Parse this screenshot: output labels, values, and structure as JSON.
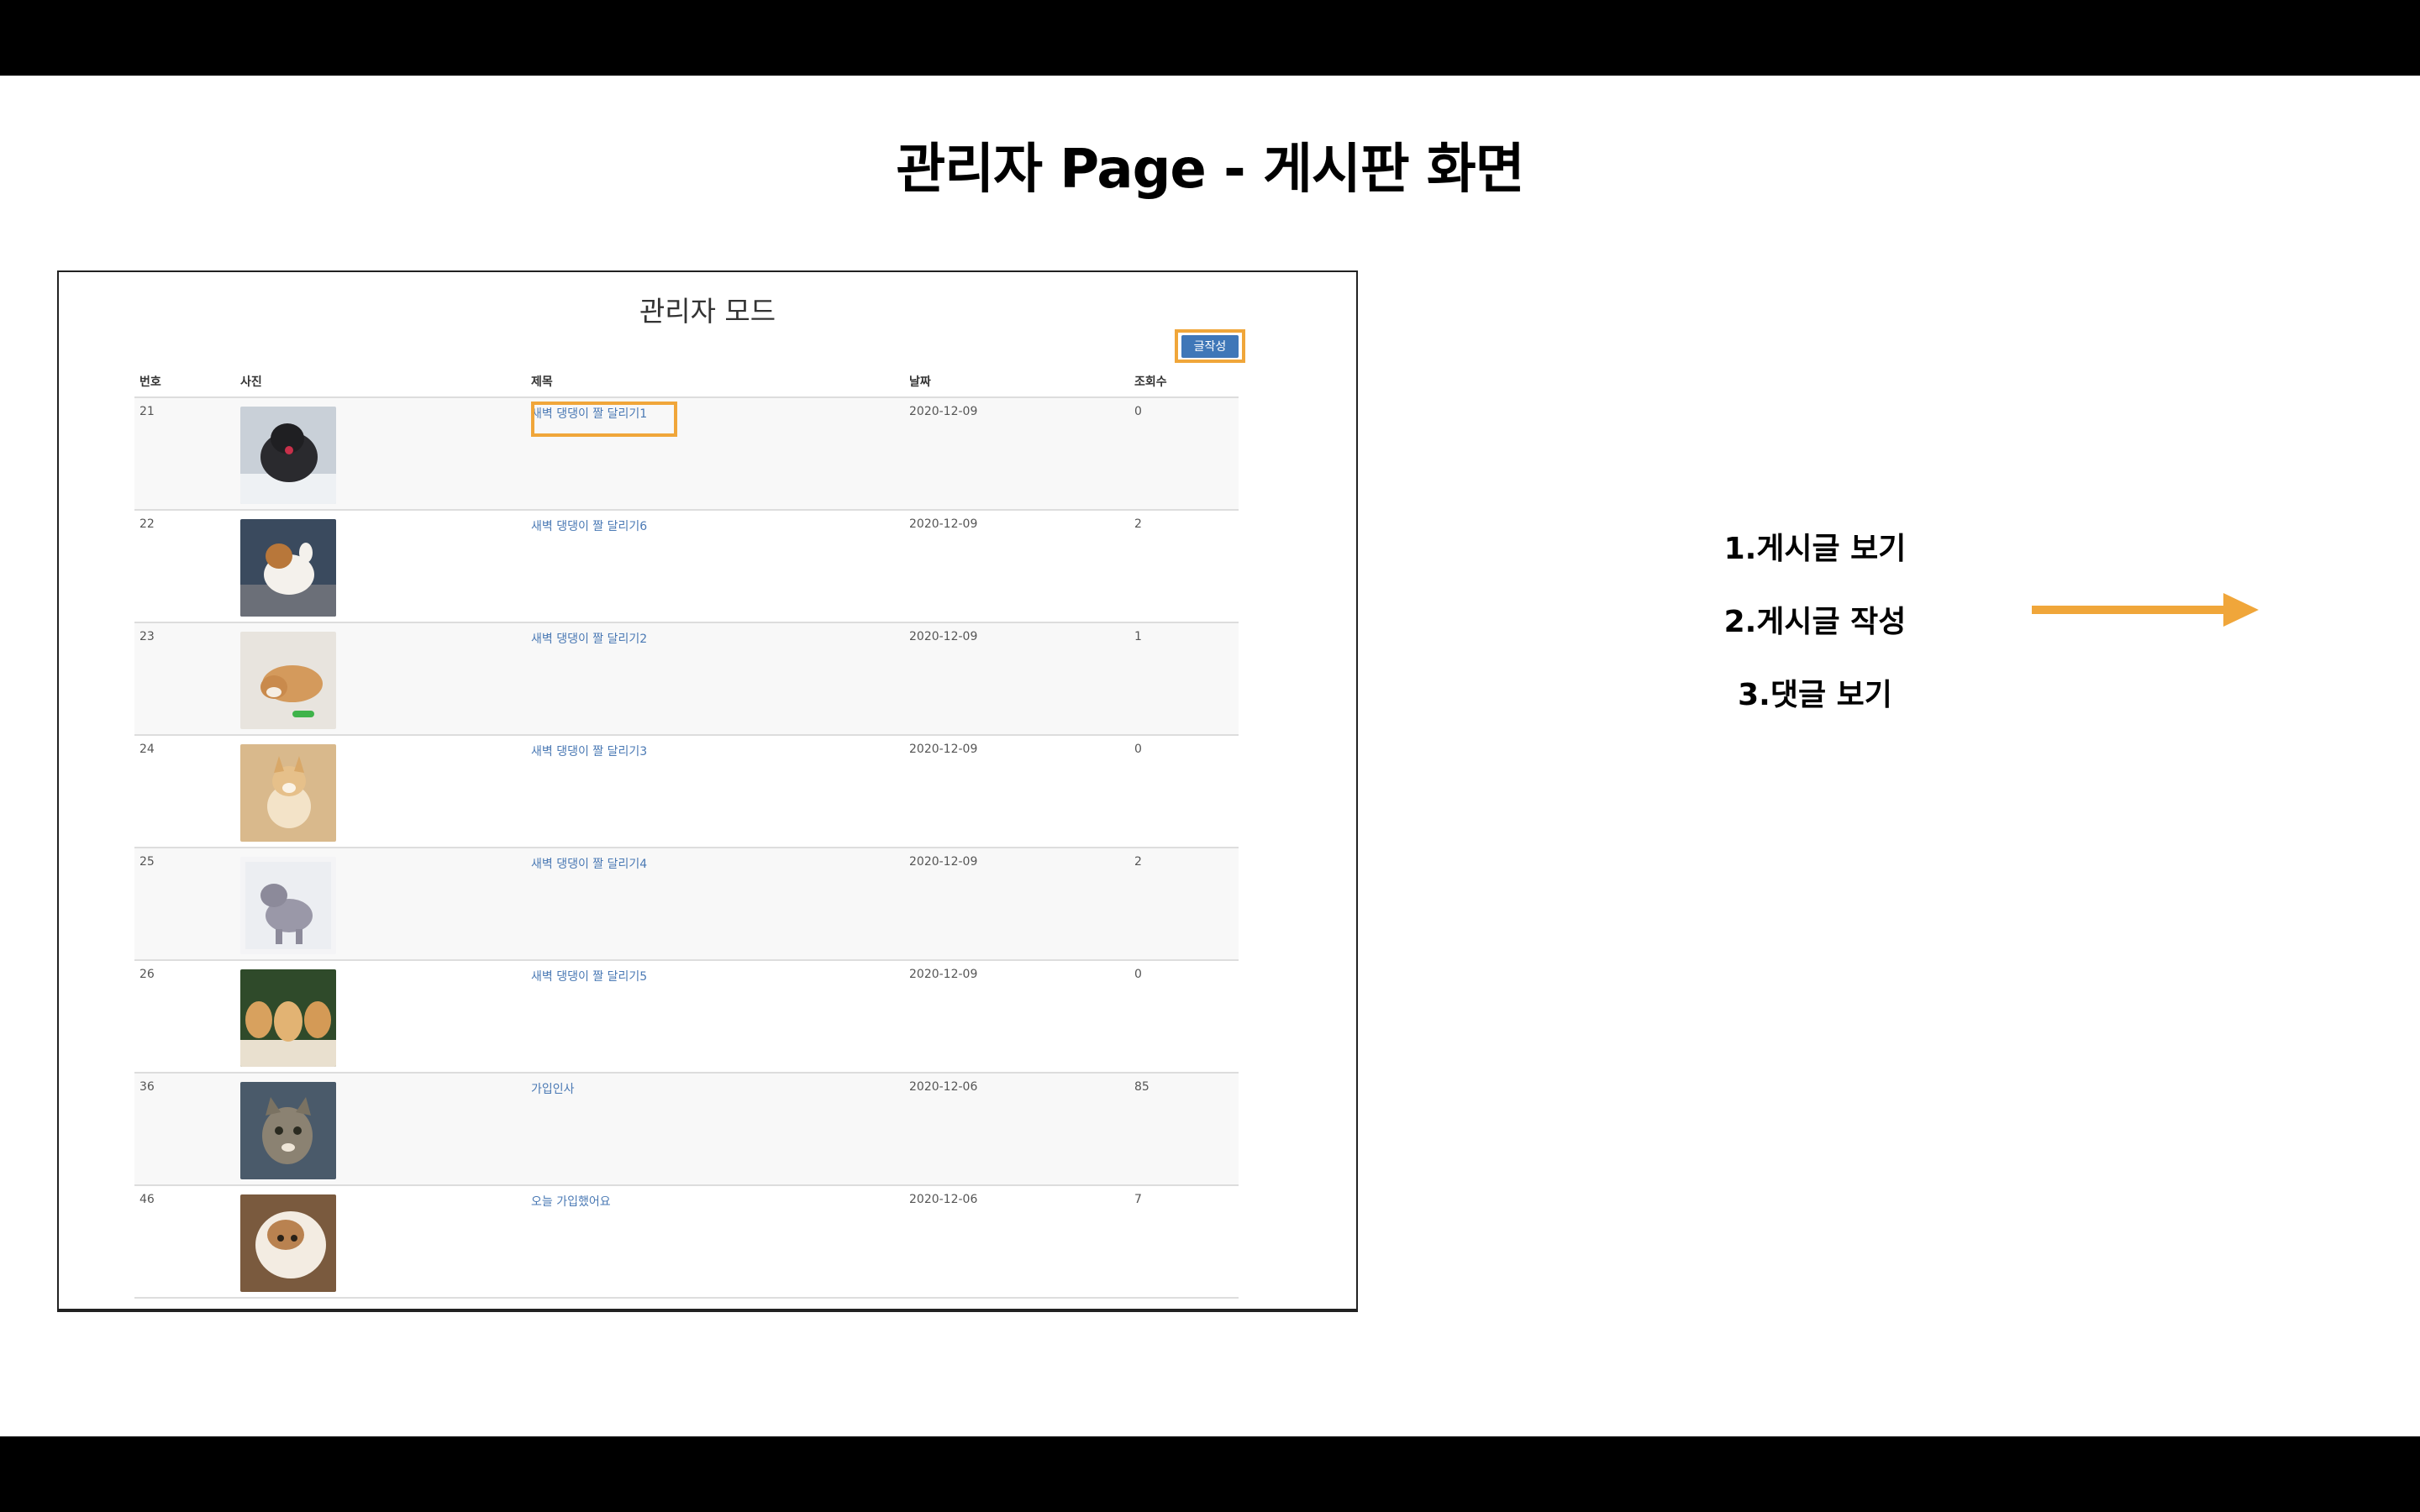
{
  "slide": {
    "title": "관리자 Page - 게시판 화면"
  },
  "admin_page": {
    "title": "관리자 모드",
    "write_button": "글작성",
    "columns": [
      "번호",
      "사진",
      "제목",
      "날짜",
      "조회수"
    ],
    "rows": [
      {
        "no": "21",
        "title": "새벽 댕댕이 짤 달리기1",
        "date": "2020-12-09",
        "views": "0",
        "photo_icon": "puppy-photo-black"
      },
      {
        "no": "22",
        "title": "새벽 댕댕이 짤 달리기6",
        "date": "2020-12-09",
        "views": "2",
        "photo_icon": "puppy-photo-brown-white"
      },
      {
        "no": "23",
        "title": "새벽 댕댕이 짤 달리기2",
        "date": "2020-12-09",
        "views": "1",
        "photo_icon": "puppy-photo-shiba"
      },
      {
        "no": "24",
        "title": "새벽 댕댕이 짤 달리기3",
        "date": "2020-12-09",
        "views": "0",
        "photo_icon": "puppy-photo-corgi"
      },
      {
        "no": "25",
        "title": "새벽 댕댕이 짤 달리기4",
        "date": "2020-12-09",
        "views": "2",
        "photo_icon": "puppy-photo-grey"
      },
      {
        "no": "26",
        "title": "새벽 댕댕이 짤 달리기5",
        "date": "2020-12-09",
        "views": "0",
        "photo_icon": "puppies-photo-group"
      },
      {
        "no": "36",
        "title": "가입인사",
        "date": "2020-12-06",
        "views": "85",
        "photo_icon": "cat-photo-tabby"
      },
      {
        "no": "46",
        "title": "오늘 가입했어요",
        "date": "2020-12-06",
        "views": "7",
        "photo_icon": "cat-photo-white-brown"
      }
    ]
  },
  "annotations": {
    "items": [
      "1.게시글 보기",
      "2.게시글 작성",
      "3.댓글 보기"
    ]
  },
  "colors": {
    "highlight": "#f0a63a",
    "button": "#3f77b8",
    "link": "#4a79b4"
  }
}
